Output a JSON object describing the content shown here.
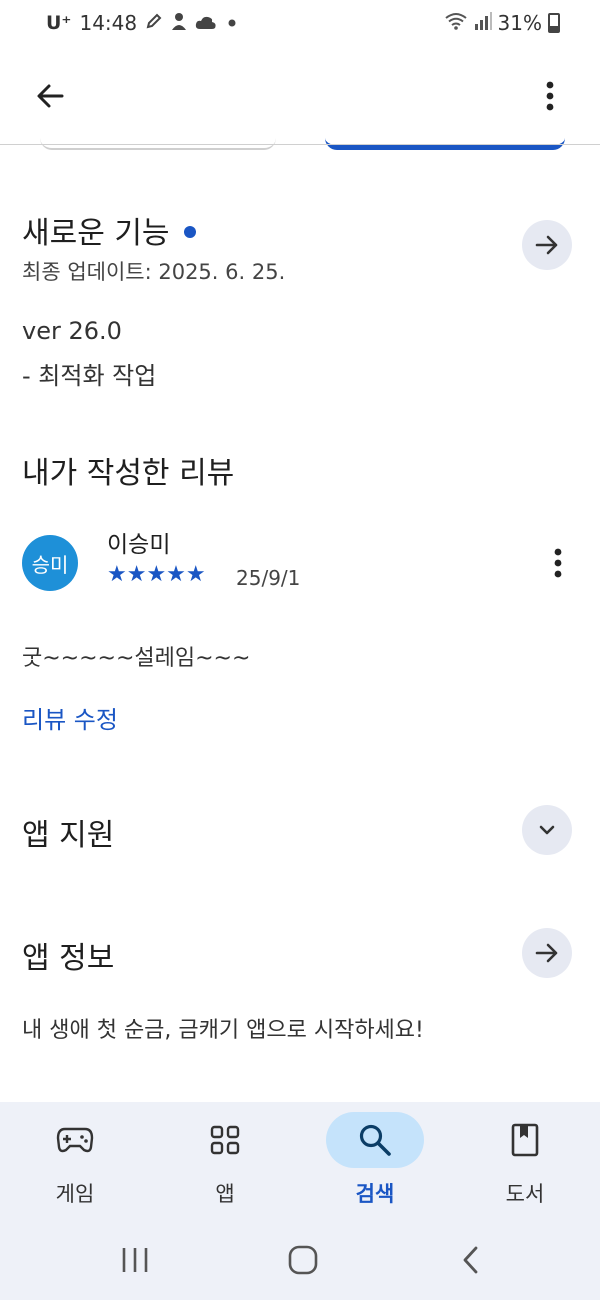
{
  "status_bar": {
    "carrier": "U⁺",
    "time": "14:48",
    "battery": "31%"
  },
  "whats_new": {
    "title": "새로운 기능",
    "last_updated": "최종 업데이트: 2025. 6. 25.",
    "version": "ver 26.0",
    "notes": "- 최적화 작업"
  },
  "my_review": {
    "section_title": "내가 작성한 리뷰",
    "avatar_text": "승미",
    "reviewer_name": "이승미",
    "rating": 5,
    "stars": "★★★★★",
    "date": "25/9/1",
    "text": "굿~~~~~설레임~~~",
    "edit_label": "리뷰 수정"
  },
  "app_support": {
    "title": "앱 지원"
  },
  "app_info": {
    "title": "앱 정보",
    "description": "내 생애 첫 순금, 금캐기 앱으로 시작하세요!"
  },
  "bottom_nav": {
    "items": [
      {
        "label": "게임",
        "icon": "gamepad-icon"
      },
      {
        "label": "앱",
        "icon": "apps-grid-icon"
      },
      {
        "label": "검색",
        "icon": "search-icon",
        "active": true
      },
      {
        "label": "도서",
        "icon": "book-icon"
      }
    ]
  },
  "colors": {
    "accent": "#1a56c4",
    "nav_active_bg": "#c5e3fb",
    "avatar_bg": "#1e90d8",
    "nav_bg": "#eef1f8"
  }
}
